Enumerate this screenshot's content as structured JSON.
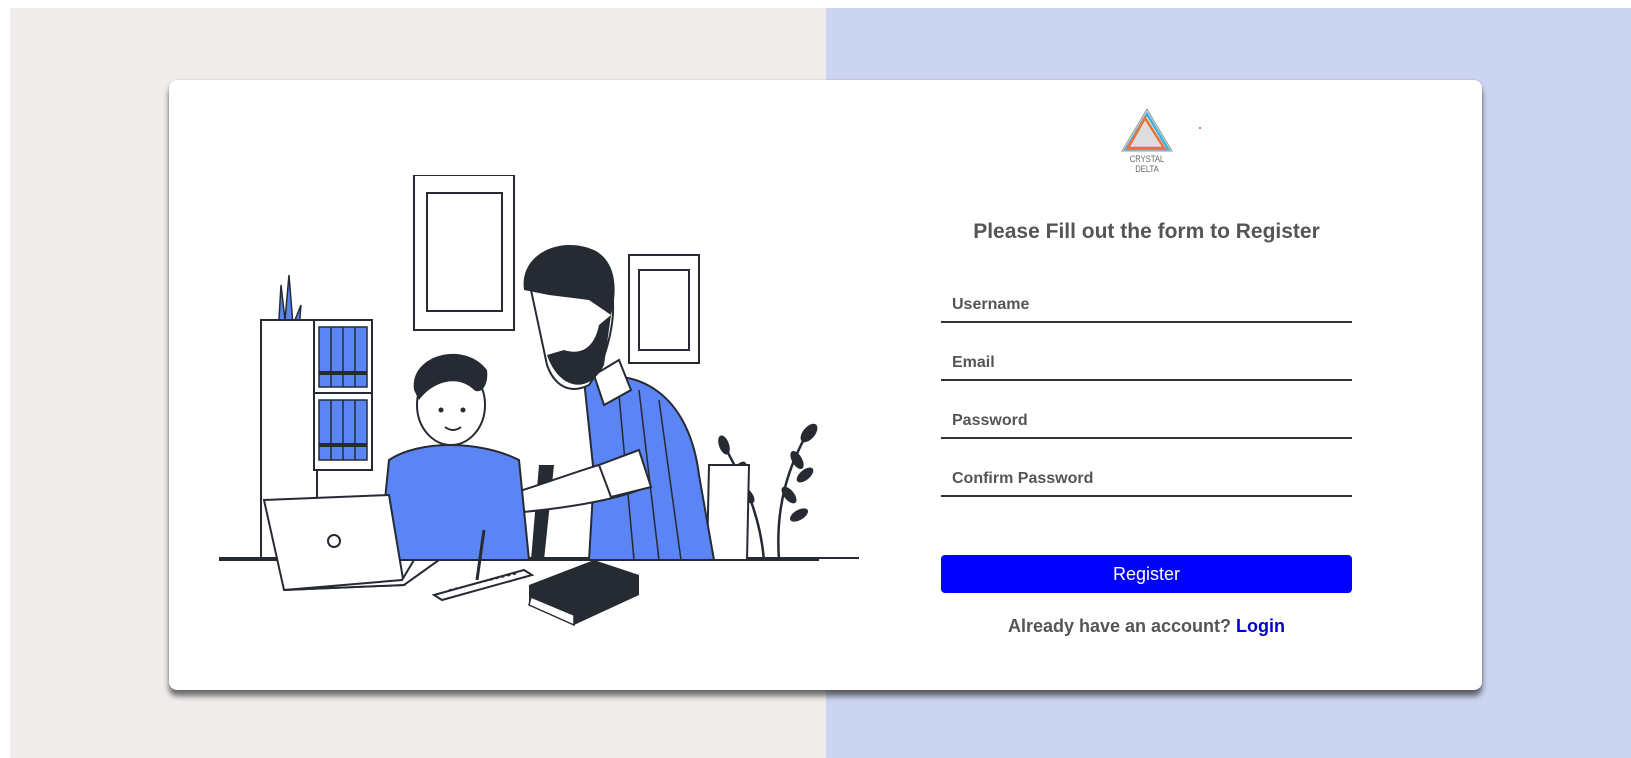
{
  "brand": {
    "logo_text": "CRYSTAL DELTA",
    "colors": {
      "triangle_orange": "#e8743a",
      "triangle_blue": "#38b6e0",
      "triangle_grey": "#9a9a9a"
    }
  },
  "form": {
    "heading": "Please Fill out the form to Register",
    "username_placeholder": "Username",
    "email_placeholder": "Email",
    "password_placeholder": "Password",
    "confirm_password_placeholder": "Confirm Password",
    "register_label": "Register",
    "account_prompt": "Already have an account?",
    "login_label": "Login"
  },
  "colors": {
    "accent": "#0000ff",
    "illustration_blue": "#5b84f4",
    "illustration_dark": "#262b33",
    "page_left_bg": "#f0ecec",
    "page_right_bg": "#cbd4f0"
  },
  "illustration": {
    "icon": "tutoring-illustration"
  }
}
